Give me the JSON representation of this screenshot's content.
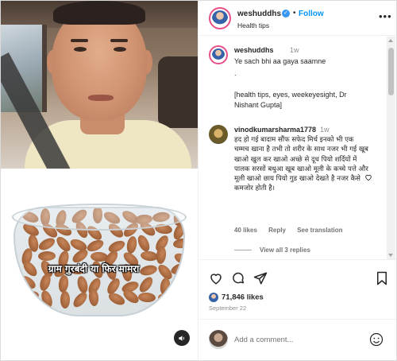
{
  "header": {
    "username": "weshuddhs",
    "follow_label": "Follow",
    "subtitle": "Health tips",
    "separator": "•"
  },
  "media": {
    "overlay_text": "ग्राम गुरबंदी या फिर मामरा",
    "sound_icon": "speaker-icon"
  },
  "caption": {
    "username": "weshuddhs",
    "time": "1w",
    "line1": "Ye sach bhi aa gaya saamne",
    "line2": ".",
    "line3": "[health tips, eyes, weekeyesight, Dr",
    "line4": "Nishant Gupta]"
  },
  "comment": {
    "username": "vinodkumarsharma1778",
    "time": "1w",
    "text": "हद हो गई बादाम सौंफ सफेद मिर्च इनको भी एक चम्मच खाना है तभी तो शरीर के साथ नजर भी गई खूब खाओ खुल कर खाओ अच्छे से दूध पियो शर्दियों में पालक सरसों बथुआ खूब खाओ मूली के कच्चे पत्ते और मूली खाओ छाय पियो गुड खाओ देखते है नजर कैसे कमजोर होती है।",
    "likes": "40 likes",
    "reply": "Reply",
    "see_translation": "See translation",
    "view_replies": "View all 3 replies"
  },
  "actions": {
    "likes": "71,846 likes",
    "date": "September 22"
  },
  "add_comment": {
    "placeholder": "Add a comment..."
  },
  "colors": {
    "accent": "#0095f6",
    "verified": "#3897f0",
    "story_ring": "#e8508a"
  }
}
